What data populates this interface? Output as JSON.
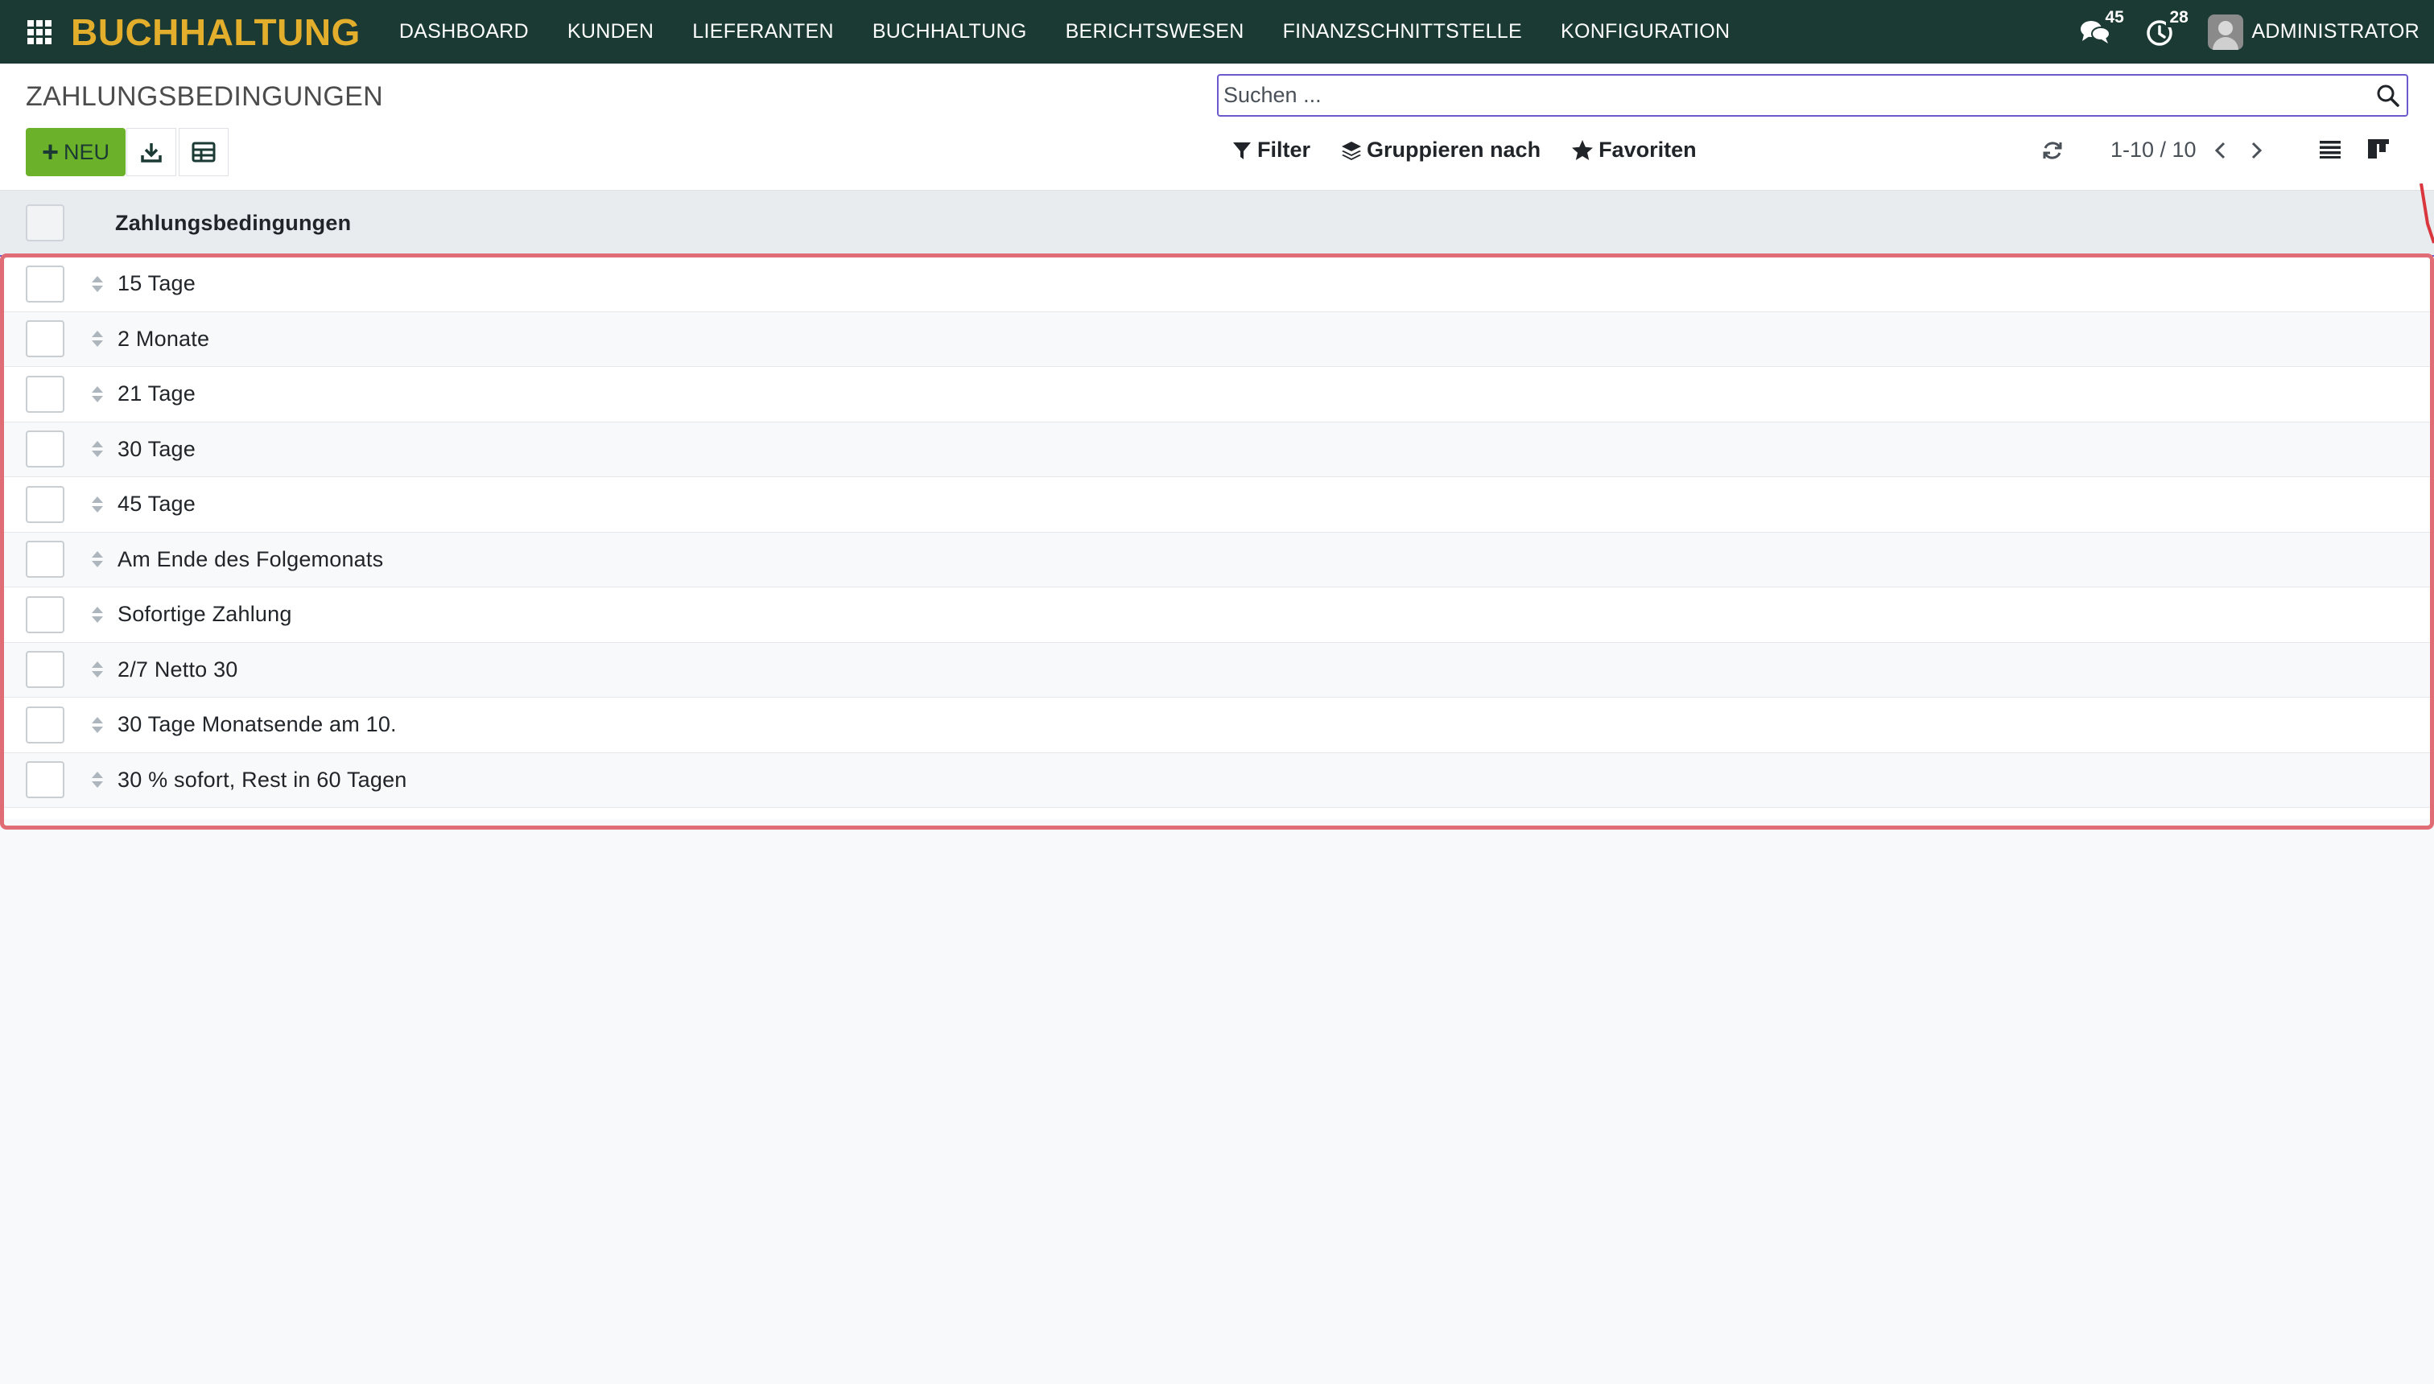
{
  "navbar": {
    "app_name": "BUCHHALTUNG",
    "menu": [
      "DASHBOARD",
      "KUNDEN",
      "LIEFERANTEN",
      "BUCHHALTUNG",
      "BERICHTSWESEN",
      "FINANZSCHNITTSTELLE",
      "KONFIGURATION"
    ],
    "messages_count": "45",
    "activities_count": "28",
    "user": "ADMINISTRATOR"
  },
  "control_panel": {
    "title": "ZAHLUNGSBEDINGUNGEN",
    "search_placeholder": "Suchen ...",
    "new_label": "NEU",
    "filter_label": "Filter",
    "group_label": "Gruppieren nach",
    "favorites_label": "Favoriten",
    "pager_value": "1-10 / 10"
  },
  "list": {
    "column_header": "Zahlungsbedingungen",
    "rows": [
      "15 Tage",
      "2 Monate",
      "21 Tage",
      "30 Tage",
      "45 Tage",
      "Am Ende des Folgemonats",
      "Sofortige Zahlung",
      "2/7 Netto 30",
      "30 Tage Monatsende am 10.",
      "30 % sofort, Rest in 60 Tagen"
    ]
  },
  "colors": {
    "navbar_bg": "#1b3a33",
    "brand": "#e2ae2c",
    "primary_button": "#6cb12a",
    "search_border": "#6a5acd",
    "highlight": "#e06c75"
  },
  "icons": {
    "apps": "apps-grid-icon",
    "messages": "chat-icon",
    "activities": "clock-icon",
    "search": "search-icon",
    "download": "download-icon",
    "table": "table-icon",
    "filter": "filter-icon",
    "group": "layers-icon",
    "favorites": "star-icon",
    "refresh": "refresh-icon",
    "list_view": "list-view-icon",
    "kanban_view": "kanban-view-icon",
    "handle": "drag-handle-icon"
  }
}
